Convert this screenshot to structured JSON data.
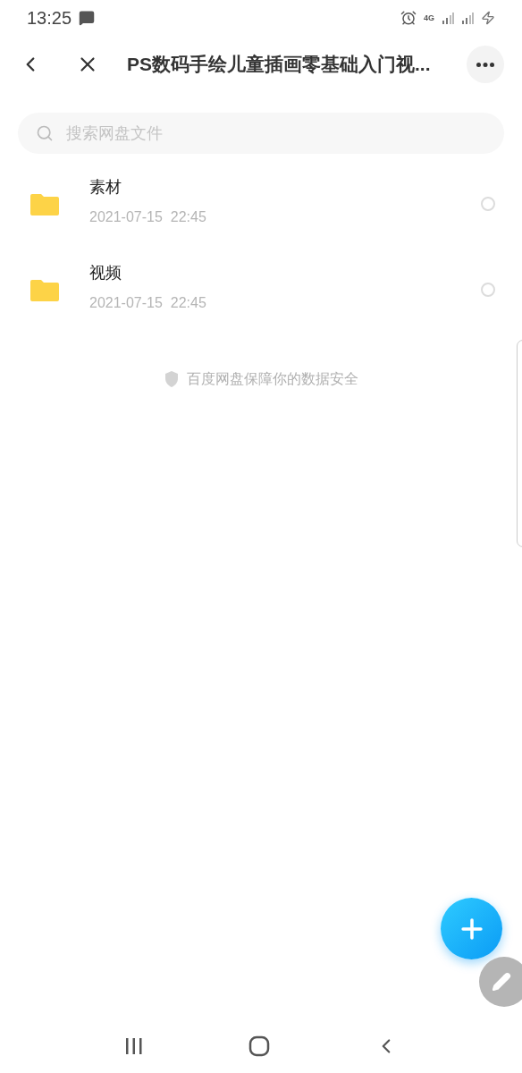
{
  "status_bar": {
    "time": "13:25",
    "network": "4G"
  },
  "header": {
    "title": "PS数码手绘儿童插画零基础入门视..."
  },
  "search": {
    "placeholder": "搜索网盘文件"
  },
  "files": [
    {
      "name": "素材",
      "date": "2021-07-15  22:45",
      "selected": false
    },
    {
      "name": "视频",
      "date": "2021-07-15  22:45",
      "selected": false
    }
  ],
  "security_note": "百度网盘保障你的数据安全"
}
